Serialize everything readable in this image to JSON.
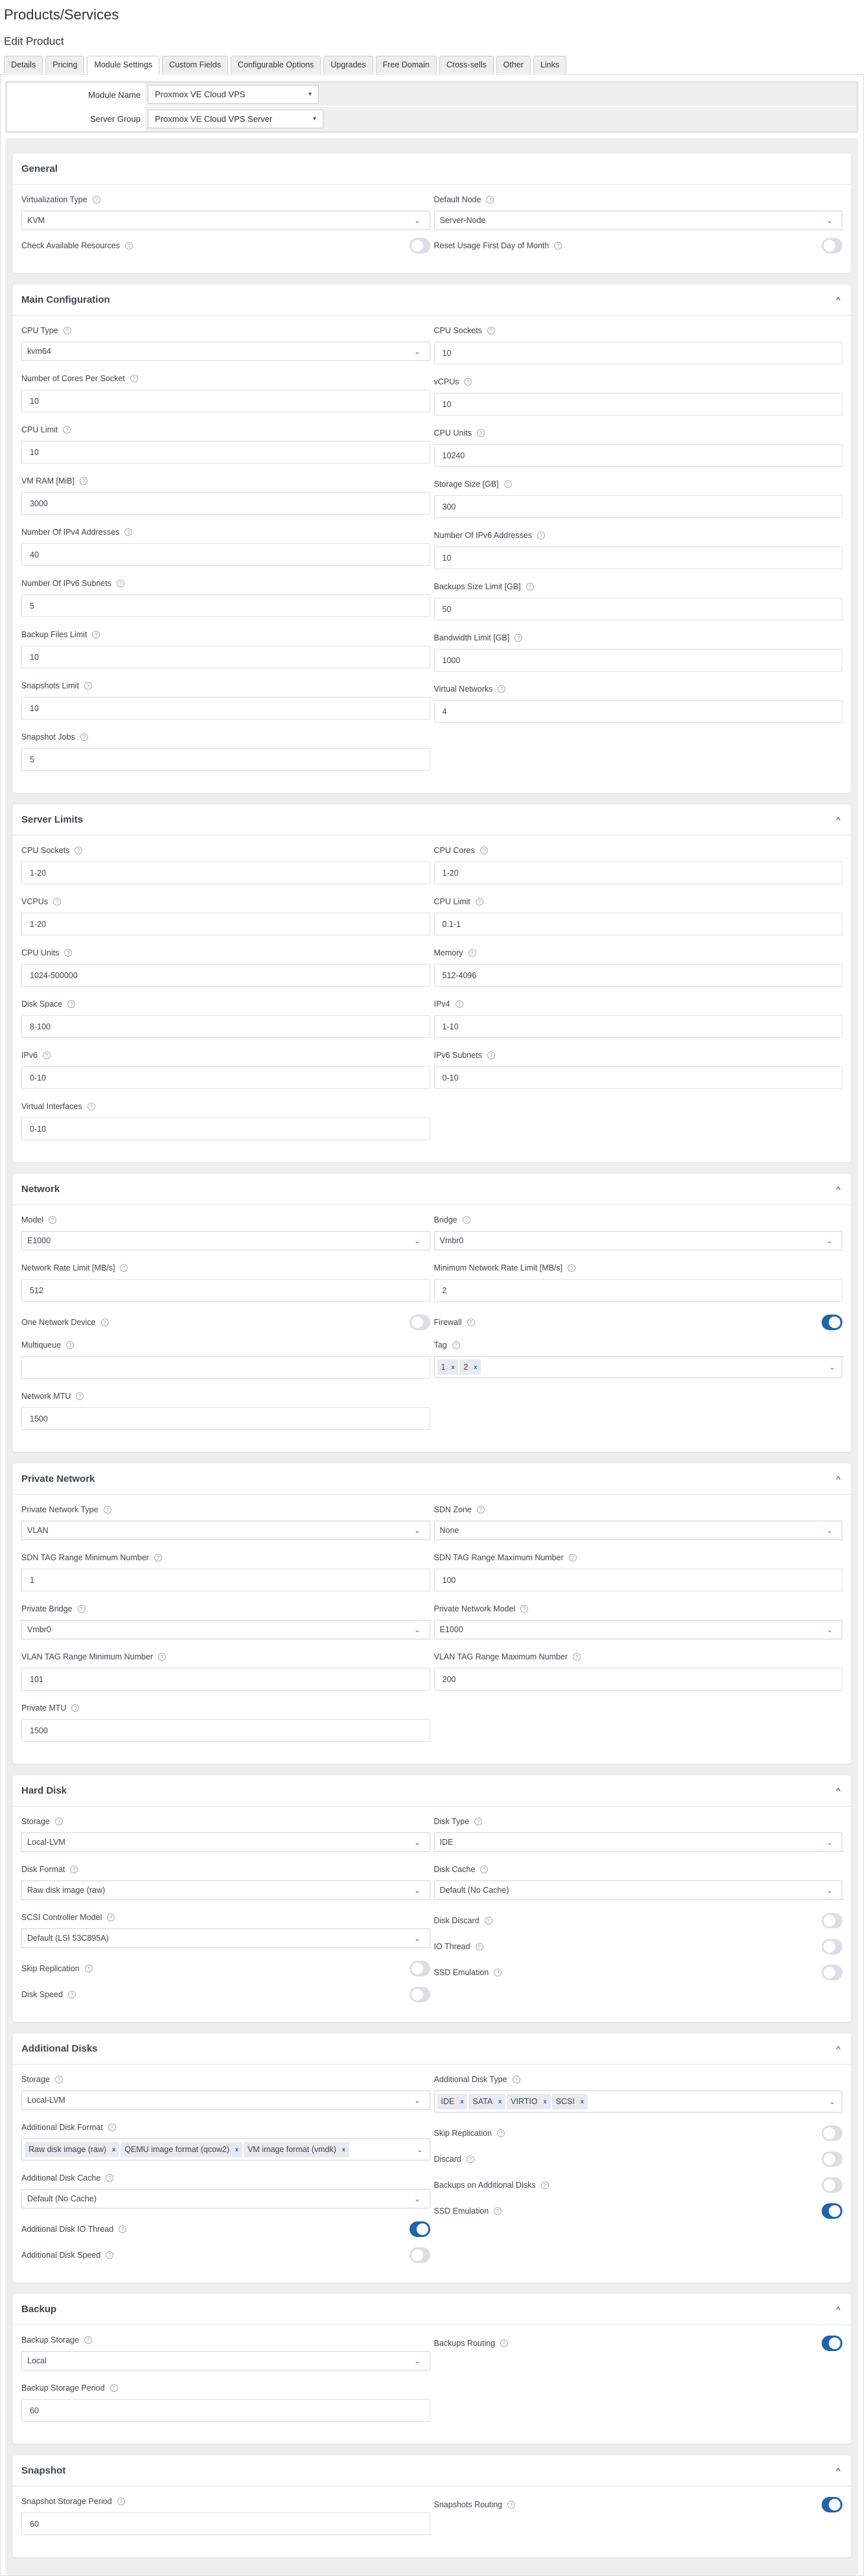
{
  "page": {
    "title": "Products/Services",
    "subtitle": "Edit Product"
  },
  "tabs": [
    {
      "label": "Details",
      "active": false
    },
    {
      "label": "Pricing",
      "active": false
    },
    {
      "label": "Module Settings",
      "active": true
    },
    {
      "label": "Custom Fields",
      "active": false
    },
    {
      "label": "Configurable Options",
      "active": false
    },
    {
      "label": "Upgrades",
      "active": false
    },
    {
      "label": "Free Domain",
      "active": false
    },
    {
      "label": "Cross-sells",
      "active": false
    },
    {
      "label": "Other",
      "active": false
    },
    {
      "label": "Links",
      "active": false
    }
  ],
  "module": {
    "module_name_label": "Module Name",
    "module_name_value": "Proxmox VE Cloud VPS",
    "server_group_label": "Server Group",
    "server_group_value": "Proxmox VE Cloud VPS Server"
  },
  "icons": {
    "help": "?",
    "chevron_down": "⌄",
    "chevron_up": "^",
    "chip_remove": "x"
  },
  "colors": {
    "accent": "#1f64ab",
    "toggle_off": "#dcdee6"
  },
  "general": {
    "title": "General",
    "virtualization_type": {
      "label": "Virtualization Type",
      "value": "KVM"
    },
    "default_node": {
      "label": "Default Node",
      "value": "Server-Node"
    },
    "check_available_resources": {
      "label": "Check Available Resources",
      "on": false
    },
    "reset_usage": {
      "label": "Reset Usage First Day of Month",
      "on": false
    }
  },
  "main_configuration": {
    "title": "Main Configuration",
    "cpu_type": {
      "label": "CPU Type",
      "value": "kvm64"
    },
    "cpu_sockets": {
      "label": "CPU Sockets",
      "value": "10"
    },
    "cores_per_socket": {
      "label": "Number of Cores Per Socket",
      "value": "10"
    },
    "vcpus": {
      "label": "vCPUs",
      "value": "10"
    },
    "cpu_limit": {
      "label": "CPU Limit",
      "value": "10"
    },
    "cpu_units": {
      "label": "CPU Units",
      "value": "10240"
    },
    "vm_ram": {
      "label": "VM RAM [MiB]",
      "value": "3000"
    },
    "storage_size": {
      "label": "Storage Size [GB]",
      "value": "300"
    },
    "ipv4_addresses": {
      "label": "Number Of IPv4 Addresses",
      "value": "40"
    },
    "ipv6_addresses": {
      "label": "Number Of IPv6 Addresses",
      "value": "10"
    },
    "ipv6_subnets": {
      "label": "Number Of IPv6 Subnets",
      "value": "5"
    },
    "backups_size_limit": {
      "label": "Backups Size Limit [GB]",
      "value": "50"
    },
    "backup_files_limit": {
      "label": "Backup Files Limit",
      "value": "10"
    },
    "bandwidth_limit": {
      "label": "Bandwidth Limit [GB]",
      "value": "1000"
    },
    "snapshots_limit": {
      "label": "Snapshots Limit",
      "value": "10"
    },
    "virtual_networks": {
      "label": "Virtual Networks",
      "value": "4"
    },
    "snapshot_jobs": {
      "label": "Snapshot Jobs",
      "value": "5"
    }
  },
  "server_limits": {
    "title": "Server Limits",
    "cpu_sockets": {
      "label": "CPU Sockets",
      "value": "1-20"
    },
    "cpu_cores": {
      "label": "CPU Cores",
      "value": "1-20"
    },
    "vcpus": {
      "label": "VCPUs",
      "value": "1-20"
    },
    "cpu_limit": {
      "label": "CPU Limit",
      "value": "0.1-1"
    },
    "cpu_units": {
      "label": "CPU Units",
      "value": "1024-500000"
    },
    "memory": {
      "label": "Memory",
      "value": "512-4096"
    },
    "disk_space": {
      "label": "Disk Space",
      "value": "8-100"
    },
    "ipv4": {
      "label": "IPv4",
      "value": "1-10"
    },
    "ipv6": {
      "label": "IPv6",
      "value": "0-10"
    },
    "ipv6_subnets": {
      "label": "IPv6 Subnets",
      "value": "0-10"
    },
    "virtual_interfaces": {
      "label": "Virtual Interfaces",
      "value": "0-10"
    }
  },
  "network": {
    "title": "Network",
    "model": {
      "label": "Model",
      "value": "E1000"
    },
    "bridge": {
      "label": "Bridge",
      "value": "Vmbr0"
    },
    "rate_limit": {
      "label": "Network Rate Limit [MB/s]",
      "value": "512"
    },
    "min_rate_limit": {
      "label": "Minimum Network Rate Limit [MB/s]",
      "value": "2"
    },
    "one_network_device": {
      "label": "One Network Device",
      "on": false
    },
    "firewall": {
      "label": "Firewall",
      "on": true
    },
    "multiqueue": {
      "label": "Multiqueue",
      "value": ""
    },
    "tag": {
      "label": "Tag",
      "chips": [
        "1",
        "2"
      ]
    },
    "mtu": {
      "label": "Network MTU",
      "value": "1500"
    }
  },
  "private_network": {
    "title": "Private Network",
    "type": {
      "label": "Private Network Type",
      "value": "VLAN"
    },
    "sdn_zone": {
      "label": "SDN Zone",
      "value": "None"
    },
    "sdn_min": {
      "label": "SDN TAG Range Minimum Number",
      "value": "1"
    },
    "sdn_max": {
      "label": "SDN TAG Range Maximum Number",
      "value": "100"
    },
    "bridge": {
      "label": "Private Bridge",
      "value": "Vmbr0"
    },
    "model": {
      "label": "Private Network Model",
      "value": "E1000"
    },
    "vlan_min": {
      "label": "VLAN TAG Range Minimum Number",
      "value": "101"
    },
    "vlan_max": {
      "label": "VLAN TAG Range Maximum Number",
      "value": "200"
    },
    "mtu": {
      "label": "Private MTU",
      "value": "1500"
    }
  },
  "hard_disk": {
    "title": "Hard Disk",
    "storage": {
      "label": "Storage",
      "value": "Local-LVM"
    },
    "disk_type": {
      "label": "Disk Type",
      "value": "IDE"
    },
    "disk_format": {
      "label": "Disk Format",
      "value": "Raw disk image (raw)"
    },
    "disk_cache": {
      "label": "Disk Cache",
      "value": "Default (No Cache)"
    },
    "scsi_controller": {
      "label": "SCSI Controller Model",
      "value": "Default (LSI 53C895A)"
    },
    "disk_discard": {
      "label": "Disk Discard",
      "on": false
    },
    "io_thread": {
      "label": "IO Thread",
      "on": false
    },
    "skip_replication": {
      "label": "Skip Replication",
      "on": false
    },
    "ssd_emulation": {
      "label": "SSD Emulation",
      "on": false
    },
    "disk_speed": {
      "label": "Disk Speed",
      "on": false
    }
  },
  "additional_disks": {
    "title": "Additional Disks",
    "storage": {
      "label": "Storage",
      "value": "Local-LVM"
    },
    "disk_type": {
      "label": "Additional Disk Type",
      "chips": [
        "IDE",
        "SATA",
        "VIRTIO",
        "SCSI"
      ]
    },
    "disk_format": {
      "label": "Additional Disk Format",
      "chips": [
        "Raw disk image (raw)",
        "QEMU image format (qcow2)",
        "VM image format (vmdk)"
      ]
    },
    "skip_replication": {
      "label": "Skip Replication",
      "on": false
    },
    "discard": {
      "label": "Discard",
      "on": false
    },
    "disk_cache": {
      "label": "Additional Disk Cache",
      "value": "Default (No Cache)"
    },
    "backups_on_additional": {
      "label": "Backups on Additional Disks",
      "on": false
    },
    "ssd_emulation": {
      "label": "SSD Emulation",
      "on": true
    },
    "io_thread": {
      "label": "Additional Disk IO Thread",
      "on": true
    },
    "disk_speed": {
      "label": "Additional Disk Speed",
      "on": false
    }
  },
  "backup": {
    "title": "Backup",
    "storage": {
      "label": "Backup Storage",
      "value": "Local"
    },
    "routing": {
      "label": "Backups Routing",
      "on": true
    },
    "period": {
      "label": "Backup Storage Period",
      "value": "60"
    }
  },
  "snapshot": {
    "title": "Snapshot",
    "period": {
      "label": "Snapshot Storage Period",
      "value": "60"
    },
    "routing": {
      "label": "Snapshots Routing",
      "on": true
    }
  }
}
